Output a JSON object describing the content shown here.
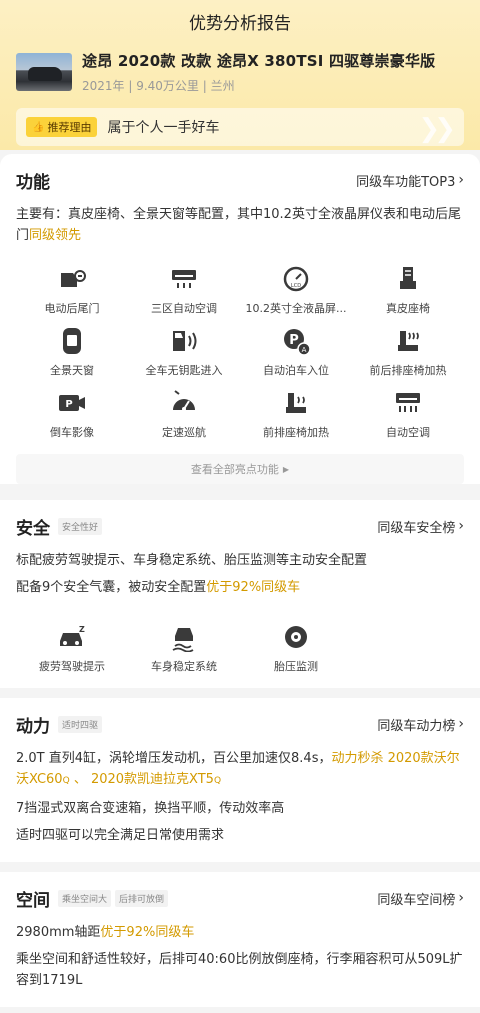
{
  "header": {
    "title": "优势分析报告"
  },
  "car": {
    "name": "途昂 2020款 改款 途昂X 380TSI 四驱尊崇豪华版",
    "meta": "2021年 | 9.40万公里 | 兰州"
  },
  "reason": {
    "tag": "推荐理由",
    "text": "属于个人一手好车"
  },
  "function": {
    "title": "功能",
    "link": "同级车功能TOP3",
    "desc_prefix": "主要有：真皮座椅、全景天窗等配置，其中10.2英寸全液晶屏仪表和电动后尾门",
    "desc_hl": "同级领先",
    "features": [
      {
        "icon": "power-tailgate-icon",
        "label": "电动后尾门"
      },
      {
        "icon": "tri-zone-ac-icon",
        "label": "三区自动空调"
      },
      {
        "icon": "lcd-dashboard-icon",
        "label": "10.2英寸全液晶屏..."
      },
      {
        "icon": "leather-seat-icon",
        "label": "真皮座椅"
      },
      {
        "icon": "panoramic-sunroof-icon",
        "label": "全景天窗"
      },
      {
        "icon": "keyless-entry-icon",
        "label": "全车无钥匙进入"
      },
      {
        "icon": "auto-parking-icon",
        "label": "自动泊车入位"
      },
      {
        "icon": "seat-heating-icon",
        "label": "前后排座椅加热"
      },
      {
        "icon": "rear-camera-icon",
        "label": "倒车影像"
      },
      {
        "icon": "cruise-control-icon",
        "label": "定速巡航"
      },
      {
        "icon": "front-seat-heating-icon",
        "label": "前排座椅加热"
      },
      {
        "icon": "auto-ac-icon",
        "label": "自动空调"
      }
    ],
    "more": "查看全部亮点功能"
  },
  "safety": {
    "title": "安全",
    "chip": "安全性好",
    "link": "同级车安全榜",
    "line1": "标配疲劳驾驶提示、车身稳定系统、胎压监测等主动安全配置",
    "line2_prefix": "配备9个安全气囊，被动安全配置",
    "line2_hl": "优于92%同级车",
    "features": [
      {
        "icon": "fatigue-alert-icon",
        "label": "疲劳驾驶提示"
      },
      {
        "icon": "stability-control-icon",
        "label": "车身稳定系统"
      },
      {
        "icon": "tire-pressure-icon",
        "label": "胎压监测"
      }
    ]
  },
  "power": {
    "title": "动力",
    "chip": "适时四驱",
    "link": "同级车动力榜",
    "line1_prefix": "2.0T 直列4缸，涡轮增压发动机，百公里加速仅8.4s，",
    "line1_hl1": "动力秒杀 2020款沃尔沃XC60",
    "line1_sep": " 、 ",
    "line1_hl2": "2020款凯迪拉克XT5",
    "line2": "7挡湿式双离合变速箱，换挡平顺，传动效率高",
    "line3": "适时四驱可以完全满足日常使用需求"
  },
  "space": {
    "title": "空间",
    "chip1": "乘坐空间大",
    "chip2": "后排可放倒",
    "link": "同级车空间榜",
    "line1_prefix": "2980mm轴距",
    "line1_hl": "优于92%同级车",
    "line2": "乘坐空间和舒适性较好，后排可40:60比例放倒座椅，行李厢容积可从509L扩容到1719L"
  },
  "colors": {
    "accent": "#d39a00",
    "tag": "#fbd23a",
    "header_bg": "#fbe9a8"
  }
}
